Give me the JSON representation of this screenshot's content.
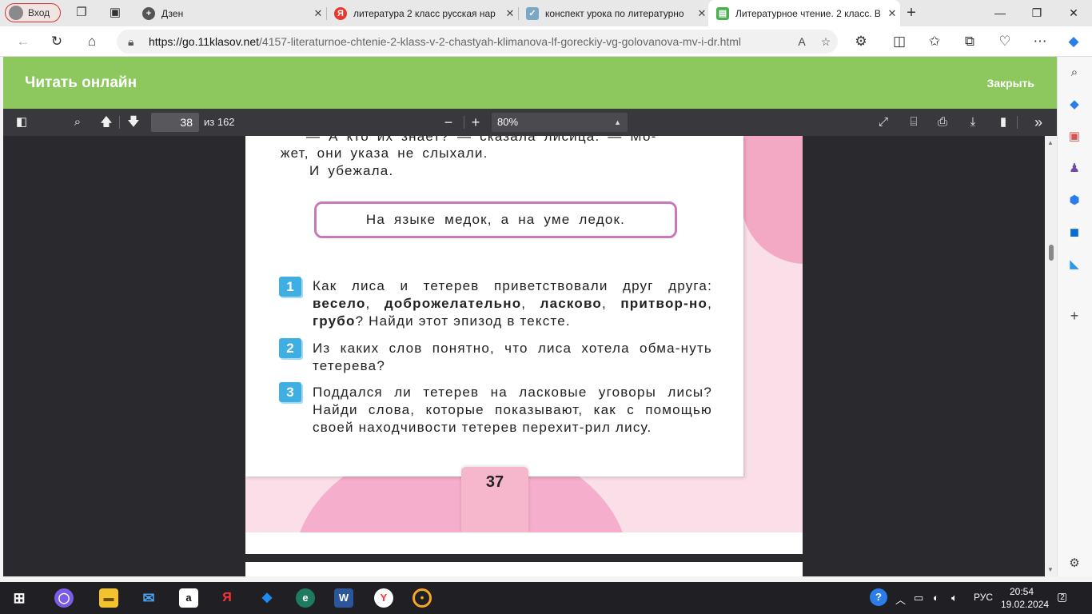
{
  "browser": {
    "profile_label": "Вход",
    "tabs": [
      {
        "title": "Дзен",
        "favicon": "dzen-icon",
        "active": false
      },
      {
        "title": "литература 2 класс русская нар",
        "favicon": "yandex-icon",
        "active": false
      },
      {
        "title": "конспект урока по литературно",
        "favicon": "checkmark-icon",
        "active": false
      },
      {
        "title": "Литературное чтение. 2 класс. В",
        "favicon": "book-icon",
        "active": true
      }
    ],
    "url_host": "https://go.11klasov.net",
    "url_path": "/4157-literaturnoe-chtenie-2-klass-v-2-chastyah-klimanova-lf-goreckiy-vg-golovanova-mv-i-dr.html",
    "accent_color": "#8dc85f"
  },
  "site": {
    "title": "Читать онлайн",
    "close_label": "Закрыть"
  },
  "pdf_toolbar": {
    "page_number": "38",
    "page_of": "из 162",
    "zoom": "80%"
  },
  "pdf_page": {
    "line1": "— А кто их знает? — сказала лисица. — Мо-",
    "line2": "жет, они указа не слыхали.",
    "line3": "И убежала.",
    "proverb": "На языке медок, а на уме ледок.",
    "questions": [
      {
        "num": "1",
        "pre": "Как лиса и тетерев приветствовали друг друга: ",
        "bold1": "весело",
        "s1": ", ",
        "bold2": "доброжелательно",
        "s2": ", ",
        "bold3": "ласково",
        "s3": ", ",
        "bold4": "притвор-но",
        "s4": ", ",
        "bold5": "грубо",
        "post": "? Найди этот эпизод в тексте."
      },
      {
        "num": "2",
        "text": "Из каких слов понятно, что лиса хотела обма-нуть тетерева?"
      },
      {
        "num": "3",
        "text": "Поддался ли тетерев на ласковые уговоры лисы? Найди слова, которые показывают, как с помощью своей находчивости тетерев перехит-рил лису."
      }
    ],
    "page_label": "37"
  },
  "taskbar": {
    "lang": "РУС",
    "time": "20:54",
    "date": "19.02.2024",
    "notifications": "2"
  }
}
